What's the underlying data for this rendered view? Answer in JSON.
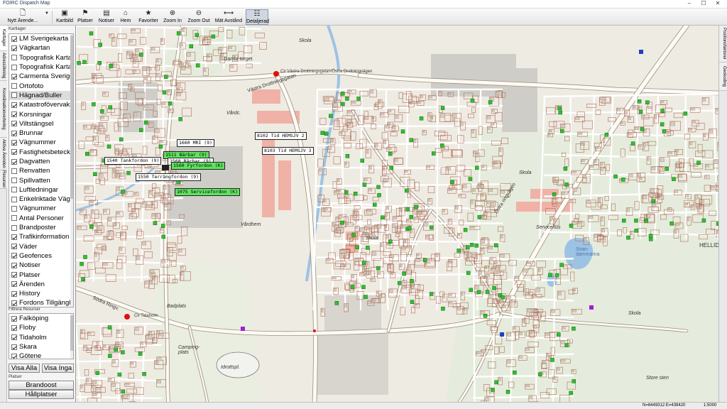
{
  "app": {
    "title": "FOIRC Dispatch Map"
  },
  "toolbar": {
    "new_case": "Nytt Ärende...",
    "buttons": [
      {
        "label": "Kartbild",
        "icon": "image-icon"
      },
      {
        "label": "Platser",
        "icon": "flag-icon"
      },
      {
        "label": "Notiser",
        "icon": "note-icon"
      },
      {
        "label": "Hem",
        "icon": "home-icon"
      },
      {
        "label": "Favoriter",
        "icon": "star-icon"
      },
      {
        "label": "Zoom In",
        "icon": "zoom-in-icon"
      },
      {
        "label": "Zoom Out",
        "icon": "zoom-out-icon"
      },
      {
        "label": "Mät Avstånd",
        "icon": "ruler-icon"
      },
      {
        "label": "Detaljerad",
        "icon": "details-icon"
      }
    ]
  },
  "left_tabs": [
    "Kartlager",
    "Adressökning",
    "Koordinatkonvertering",
    "Aktiva Ärenden",
    "Resurser"
  ],
  "map_layers": {
    "label": "Kartlager",
    "items": [
      {
        "label": "LM Sverigekarta",
        "checked": true
      },
      {
        "label": "Vägkartan",
        "checked": true
      },
      {
        "label": "Topografisk Karta",
        "checked": false
      },
      {
        "label": "Topografisk Karta",
        "checked": false
      },
      {
        "label": "Carmenta Sverige",
        "checked": true
      },
      {
        "label": "Ortofoto",
        "checked": false
      },
      {
        "label": "Hägnad/Buller",
        "checked": false
      },
      {
        "label": "Katastrofövervakning",
        "checked": true
      },
      {
        "label": "Korsningar",
        "checked": true
      },
      {
        "label": "Viltstängsel",
        "checked": true
      },
      {
        "label": "Brunnar",
        "checked": true
      },
      {
        "label": "Vägnummer",
        "checked": true
      },
      {
        "label": "Fastighetsbeteckning",
        "checked": true
      },
      {
        "label": "Dagvatten",
        "checked": true
      },
      {
        "label": "Renvatten",
        "checked": false
      },
      {
        "label": "Spillvatten",
        "checked": false
      },
      {
        "label": "Luftledningar",
        "checked": false
      },
      {
        "label": "Enkelriktade Vägar",
        "checked": false
      },
      {
        "label": "Vägnummer",
        "checked": false
      },
      {
        "label": "Antal Personer",
        "checked": false
      },
      {
        "label": "Brandposter",
        "checked": false
      },
      {
        "label": "Trafikinformation",
        "checked": true
      },
      {
        "label": "Väder",
        "checked": true
      },
      {
        "label": "Geofences",
        "checked": true
      },
      {
        "label": "Notiser",
        "checked": true
      },
      {
        "label": "Platser",
        "checked": true
      },
      {
        "label": "Ärenden",
        "checked": true
      },
      {
        "label": "History",
        "checked": true
      },
      {
        "label": "Fordons Tillgänglighet",
        "checked": true
      }
    ]
  },
  "resource_filter": {
    "label": "Filtrera Resurser",
    "items": [
      {
        "label": "Falköping",
        "checked": true
      },
      {
        "label": "Floby",
        "checked": true
      },
      {
        "label": "Tidaholm",
        "checked": true
      },
      {
        "label": "Skara",
        "checked": true
      },
      {
        "label": "Götene",
        "checked": true
      }
    ],
    "show_all": "Visa Alla",
    "show_none": "Visa Inga"
  },
  "places": {
    "label": "Platser",
    "items": [
      "Brandoost",
      "Hållplatser"
    ]
  },
  "right_tabs": [
    "Positionsfaktorer",
    "Geokoding"
  ],
  "map": {
    "callouts": [
      {
        "text": "1660 MRI (9)",
        "green": false
      },
      {
        "text": "1511 Bärbar (9)",
        "green": true
      },
      {
        "text": "1568 Bärbar (9)",
        "green": false
      },
      {
        "text": "1540 Tankfordon (9)",
        "green": false
      },
      {
        "text": "1560 Fyrfordon (K)",
        "green": true
      },
      {
        "text": "1550 Terrängfordon (9)",
        "green": false
      },
      {
        "text": "1075 Servicefordon (K)",
        "green": true
      },
      {
        "text": "8102 Tid HEMSJV 2",
        "green": false
      },
      {
        "text": "8103 Tid HEMSJV 3",
        "green": false
      }
    ],
    "labels": {
      "gamla_torget": "Gamla torget",
      "vastra_drott": "Västra Drottningsgatan",
      "cir_label": "Cir Västra Drottningsgatan/Östra Drottningvägen",
      "vardc": "Vårdc.",
      "skola1": "Skola",
      "skola2": "Skola",
      "skola3": "Skola",
      "skola4": "Skola",
      "vardhem": "Vårdhem",
      "ostra_ringvagen": "Östra ringvägen",
      "servicehus": "Servicehus",
      "svandammarna": "Svan-dammarna",
      "hellid": "HELLID",
      "badplats": "Badplats",
      "camping": "Camping-plats",
      "idrottspl": "Idrottspl.",
      "sodra_ringv": "Södra Ringv.",
      "store_sten": "Store sten",
      "cir_south": "Cir Tidaholm"
    }
  },
  "status": {
    "coords": "N=6449312 E=439420",
    "scale": "1:5000"
  },
  "colors": {
    "map_bg": "#eeebe3",
    "road": "#ffffff",
    "road_casing": "#9a8f82",
    "main_road": "#fdfaf3",
    "building": "#cfcdc8",
    "property_line": "#a86048",
    "water": "#9cc3e4",
    "green_area": "#dfe8d4",
    "marker_green": "#2fbf2f",
    "callout_green": "#5fe35f",
    "incident_red": "#e01010"
  }
}
